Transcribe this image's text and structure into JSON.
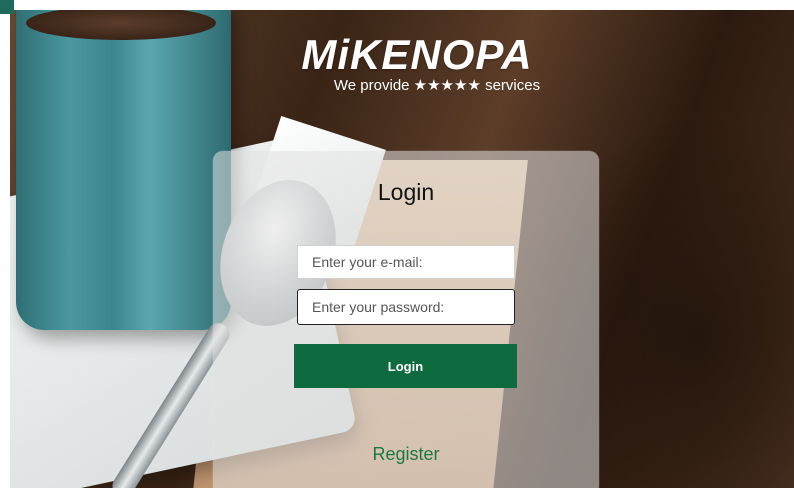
{
  "brand": {
    "name": "MiKENOPA",
    "tagline": "We provide ★★★★★ services"
  },
  "login": {
    "title": "Login",
    "email_placeholder": "Enter your e-mail:",
    "password_placeholder": "Enter your password:",
    "button_label": "Login",
    "register_label": "Register"
  },
  "colors": {
    "primary_button": "#0d6b3f",
    "register_link": "#1a7a3e"
  }
}
